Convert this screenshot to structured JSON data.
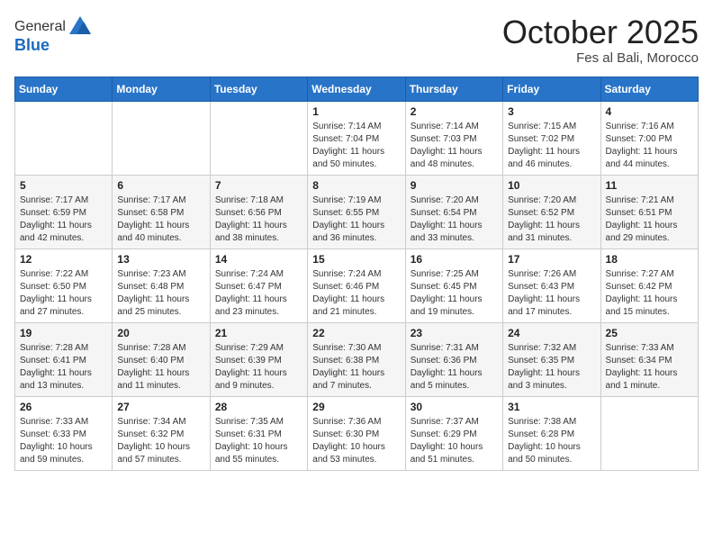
{
  "header": {
    "logo_line1": "General",
    "logo_line2": "Blue",
    "month_title": "October 2025",
    "location": "Fes al Bali, Morocco"
  },
  "weekdays": [
    "Sunday",
    "Monday",
    "Tuesday",
    "Wednesday",
    "Thursday",
    "Friday",
    "Saturday"
  ],
  "weeks": [
    [
      {
        "day": "",
        "sunrise": "",
        "sunset": "",
        "daylight": ""
      },
      {
        "day": "",
        "sunrise": "",
        "sunset": "",
        "daylight": ""
      },
      {
        "day": "",
        "sunrise": "",
        "sunset": "",
        "daylight": ""
      },
      {
        "day": "1",
        "sunrise": "Sunrise: 7:14 AM",
        "sunset": "Sunset: 7:04 PM",
        "daylight": "Daylight: 11 hours and 50 minutes."
      },
      {
        "day": "2",
        "sunrise": "Sunrise: 7:14 AM",
        "sunset": "Sunset: 7:03 PM",
        "daylight": "Daylight: 11 hours and 48 minutes."
      },
      {
        "day": "3",
        "sunrise": "Sunrise: 7:15 AM",
        "sunset": "Sunset: 7:02 PM",
        "daylight": "Daylight: 11 hours and 46 minutes."
      },
      {
        "day": "4",
        "sunrise": "Sunrise: 7:16 AM",
        "sunset": "Sunset: 7:00 PM",
        "daylight": "Daylight: 11 hours and 44 minutes."
      }
    ],
    [
      {
        "day": "5",
        "sunrise": "Sunrise: 7:17 AM",
        "sunset": "Sunset: 6:59 PM",
        "daylight": "Daylight: 11 hours and 42 minutes."
      },
      {
        "day": "6",
        "sunrise": "Sunrise: 7:17 AM",
        "sunset": "Sunset: 6:58 PM",
        "daylight": "Daylight: 11 hours and 40 minutes."
      },
      {
        "day": "7",
        "sunrise": "Sunrise: 7:18 AM",
        "sunset": "Sunset: 6:56 PM",
        "daylight": "Daylight: 11 hours and 38 minutes."
      },
      {
        "day": "8",
        "sunrise": "Sunrise: 7:19 AM",
        "sunset": "Sunset: 6:55 PM",
        "daylight": "Daylight: 11 hours and 36 minutes."
      },
      {
        "day": "9",
        "sunrise": "Sunrise: 7:20 AM",
        "sunset": "Sunset: 6:54 PM",
        "daylight": "Daylight: 11 hours and 33 minutes."
      },
      {
        "day": "10",
        "sunrise": "Sunrise: 7:20 AM",
        "sunset": "Sunset: 6:52 PM",
        "daylight": "Daylight: 11 hours and 31 minutes."
      },
      {
        "day": "11",
        "sunrise": "Sunrise: 7:21 AM",
        "sunset": "Sunset: 6:51 PM",
        "daylight": "Daylight: 11 hours and 29 minutes."
      }
    ],
    [
      {
        "day": "12",
        "sunrise": "Sunrise: 7:22 AM",
        "sunset": "Sunset: 6:50 PM",
        "daylight": "Daylight: 11 hours and 27 minutes."
      },
      {
        "day": "13",
        "sunrise": "Sunrise: 7:23 AM",
        "sunset": "Sunset: 6:48 PM",
        "daylight": "Daylight: 11 hours and 25 minutes."
      },
      {
        "day": "14",
        "sunrise": "Sunrise: 7:24 AM",
        "sunset": "Sunset: 6:47 PM",
        "daylight": "Daylight: 11 hours and 23 minutes."
      },
      {
        "day": "15",
        "sunrise": "Sunrise: 7:24 AM",
        "sunset": "Sunset: 6:46 PM",
        "daylight": "Daylight: 11 hours and 21 minutes."
      },
      {
        "day": "16",
        "sunrise": "Sunrise: 7:25 AM",
        "sunset": "Sunset: 6:45 PM",
        "daylight": "Daylight: 11 hours and 19 minutes."
      },
      {
        "day": "17",
        "sunrise": "Sunrise: 7:26 AM",
        "sunset": "Sunset: 6:43 PM",
        "daylight": "Daylight: 11 hours and 17 minutes."
      },
      {
        "day": "18",
        "sunrise": "Sunrise: 7:27 AM",
        "sunset": "Sunset: 6:42 PM",
        "daylight": "Daylight: 11 hours and 15 minutes."
      }
    ],
    [
      {
        "day": "19",
        "sunrise": "Sunrise: 7:28 AM",
        "sunset": "Sunset: 6:41 PM",
        "daylight": "Daylight: 11 hours and 13 minutes."
      },
      {
        "day": "20",
        "sunrise": "Sunrise: 7:28 AM",
        "sunset": "Sunset: 6:40 PM",
        "daylight": "Daylight: 11 hours and 11 minutes."
      },
      {
        "day": "21",
        "sunrise": "Sunrise: 7:29 AM",
        "sunset": "Sunset: 6:39 PM",
        "daylight": "Daylight: 11 hours and 9 minutes."
      },
      {
        "day": "22",
        "sunrise": "Sunrise: 7:30 AM",
        "sunset": "Sunset: 6:38 PM",
        "daylight": "Daylight: 11 hours and 7 minutes."
      },
      {
        "day": "23",
        "sunrise": "Sunrise: 7:31 AM",
        "sunset": "Sunset: 6:36 PM",
        "daylight": "Daylight: 11 hours and 5 minutes."
      },
      {
        "day": "24",
        "sunrise": "Sunrise: 7:32 AM",
        "sunset": "Sunset: 6:35 PM",
        "daylight": "Daylight: 11 hours and 3 minutes."
      },
      {
        "day": "25",
        "sunrise": "Sunrise: 7:33 AM",
        "sunset": "Sunset: 6:34 PM",
        "daylight": "Daylight: 11 hours and 1 minute."
      }
    ],
    [
      {
        "day": "26",
        "sunrise": "Sunrise: 7:33 AM",
        "sunset": "Sunset: 6:33 PM",
        "daylight": "Daylight: 10 hours and 59 minutes."
      },
      {
        "day": "27",
        "sunrise": "Sunrise: 7:34 AM",
        "sunset": "Sunset: 6:32 PM",
        "daylight": "Daylight: 10 hours and 57 minutes."
      },
      {
        "day": "28",
        "sunrise": "Sunrise: 7:35 AM",
        "sunset": "Sunset: 6:31 PM",
        "daylight": "Daylight: 10 hours and 55 minutes."
      },
      {
        "day": "29",
        "sunrise": "Sunrise: 7:36 AM",
        "sunset": "Sunset: 6:30 PM",
        "daylight": "Daylight: 10 hours and 53 minutes."
      },
      {
        "day": "30",
        "sunrise": "Sunrise: 7:37 AM",
        "sunset": "Sunset: 6:29 PM",
        "daylight": "Daylight: 10 hours and 51 minutes."
      },
      {
        "day": "31",
        "sunrise": "Sunrise: 7:38 AM",
        "sunset": "Sunset: 6:28 PM",
        "daylight": "Daylight: 10 hours and 50 minutes."
      },
      {
        "day": "",
        "sunrise": "",
        "sunset": "",
        "daylight": ""
      }
    ]
  ]
}
